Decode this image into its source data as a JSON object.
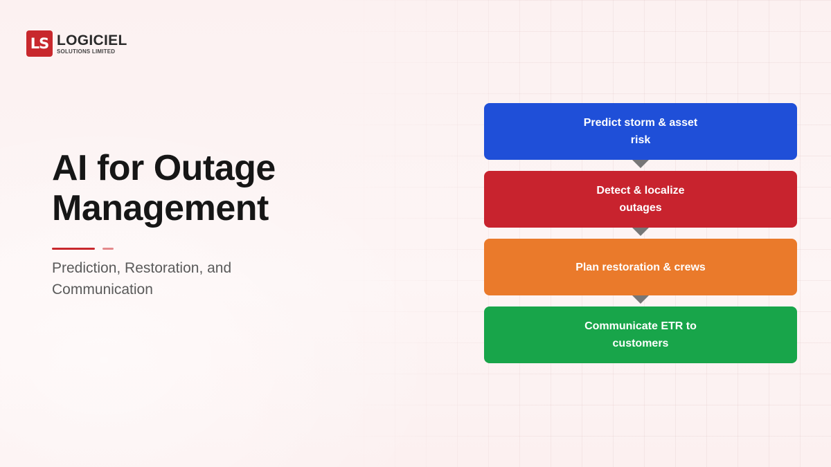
{
  "logo": {
    "mark": "LS",
    "name": "LOGICIEL",
    "subtitle": "SOLUTIONS LIMITED"
  },
  "title": {
    "line1": "AI for Outage",
    "line2": "Management"
  },
  "subtitle": "Prediction, Restoration, and Communication",
  "flow": {
    "steps": [
      {
        "label": "Predict storm & asset risk",
        "color": "#1f4fd8"
      },
      {
        "label": "Detect & localize outages",
        "color": "#c8232e"
      },
      {
        "label": "Plan restoration & crews",
        "color": "#ea7a2b"
      },
      {
        "label": "Communicate ETR to customers",
        "color": "#18a54a"
      }
    ],
    "arrow_color": "#777777"
  },
  "colors": {
    "accent": "#c8282d",
    "accent_light": "#e48a8c",
    "background": "#fdf3f3"
  }
}
